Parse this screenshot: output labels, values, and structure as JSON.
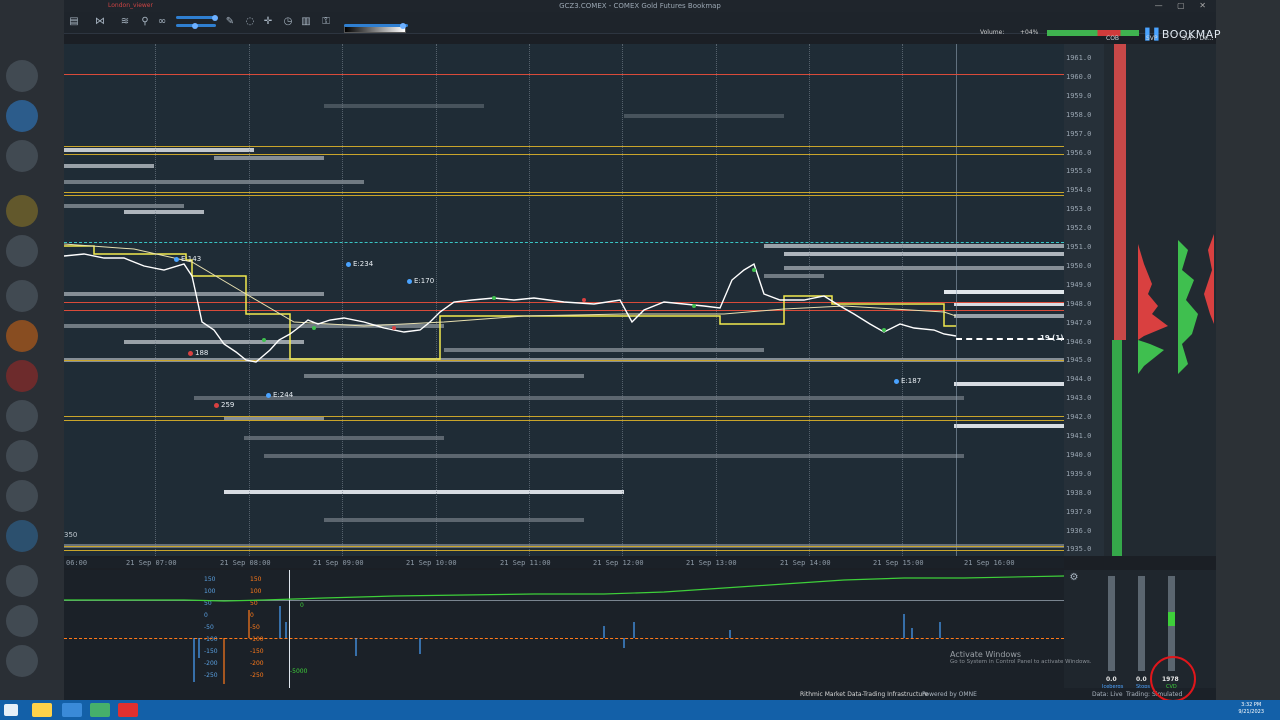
{
  "window": {
    "title": "GCZ3.COMEX - COMEX Gold Futures     Bookmap",
    "user_tag": "London_viewer"
  },
  "header": {
    "volume_label": "Volume:",
    "volume_pct": "+04%",
    "logo": "BOOKMAP"
  },
  "columns": {
    "cob": "COB",
    "svp": "SVP",
    "svp2": "SVP - De..."
  },
  "price_ticks": [
    "1961.0",
    "1960.0",
    "1959.0",
    "1958.0",
    "1957.0",
    "1956.0",
    "1955.0",
    "1954.0",
    "1953.0",
    "1952.0",
    "1951.0",
    "1950.0",
    "1949.0",
    "1948.0",
    "1947.0",
    "1946.0",
    "1945.0",
    "1944.0",
    "1943.0",
    "1942.0",
    "1941.0",
    "1940.0",
    "1939.0",
    "1938.0",
    "1937.0",
    "1936.0",
    "1935.0"
  ],
  "time_ticks": [
    "06:00",
    "21 Sep 07:00",
    "21 Sep 08:00",
    "21 Sep 09:00",
    "21 Sep 10:00",
    "21 Sep 11:00",
    "21 Sep 12:00",
    "21 Sep 13:00",
    "21 Sep 14:00",
    "21 Sep 15:00",
    "21 Sep 16:00"
  ],
  "markers": {
    "e143": "E:143",
    "e234": "E:234",
    "e170": "E:170",
    "e244": "E:244",
    "e187": "E:187",
    "r188": "188",
    "r259": "259",
    "current": "19 (1)",
    "left_val": "350"
  },
  "lower": {
    "cvd_labels": [
      "150",
      "100",
      "50",
      "0",
      "-50",
      "-100",
      "-150",
      "-200",
      "-250"
    ],
    "mid_value": "-5000",
    "zero": "0"
  },
  "gauges": [
    {
      "value": "0.0",
      "name": "Icebergs"
    },
    {
      "value": "0.0",
      "name": "Stops"
    },
    {
      "value": "1978",
      "name": "CVD"
    }
  ],
  "status": {
    "rithmic": "Rithmic  Market Data-Trading Infrastructure",
    "omne": "Powered by OMNE",
    "data": "Data: Live",
    "trading": "Trading: Simulated"
  },
  "activate": {
    "title": "Activate Windows",
    "sub": "Go to System in Control Panel to activate Windows."
  },
  "clock": {
    "time": "3:32 PM",
    "date": "9/21/2023"
  },
  "colors": {
    "bg": "#1f2c36",
    "price": "#ffffff",
    "vwap": "#f2e94e",
    "level_red": "#d94b3a",
    "buy": "#3fbf4f",
    "sell": "#d94040",
    "cvd": "#3ecf3a",
    "delta": "#4aa3ff",
    "delta2": "#ff7a1a"
  }
}
